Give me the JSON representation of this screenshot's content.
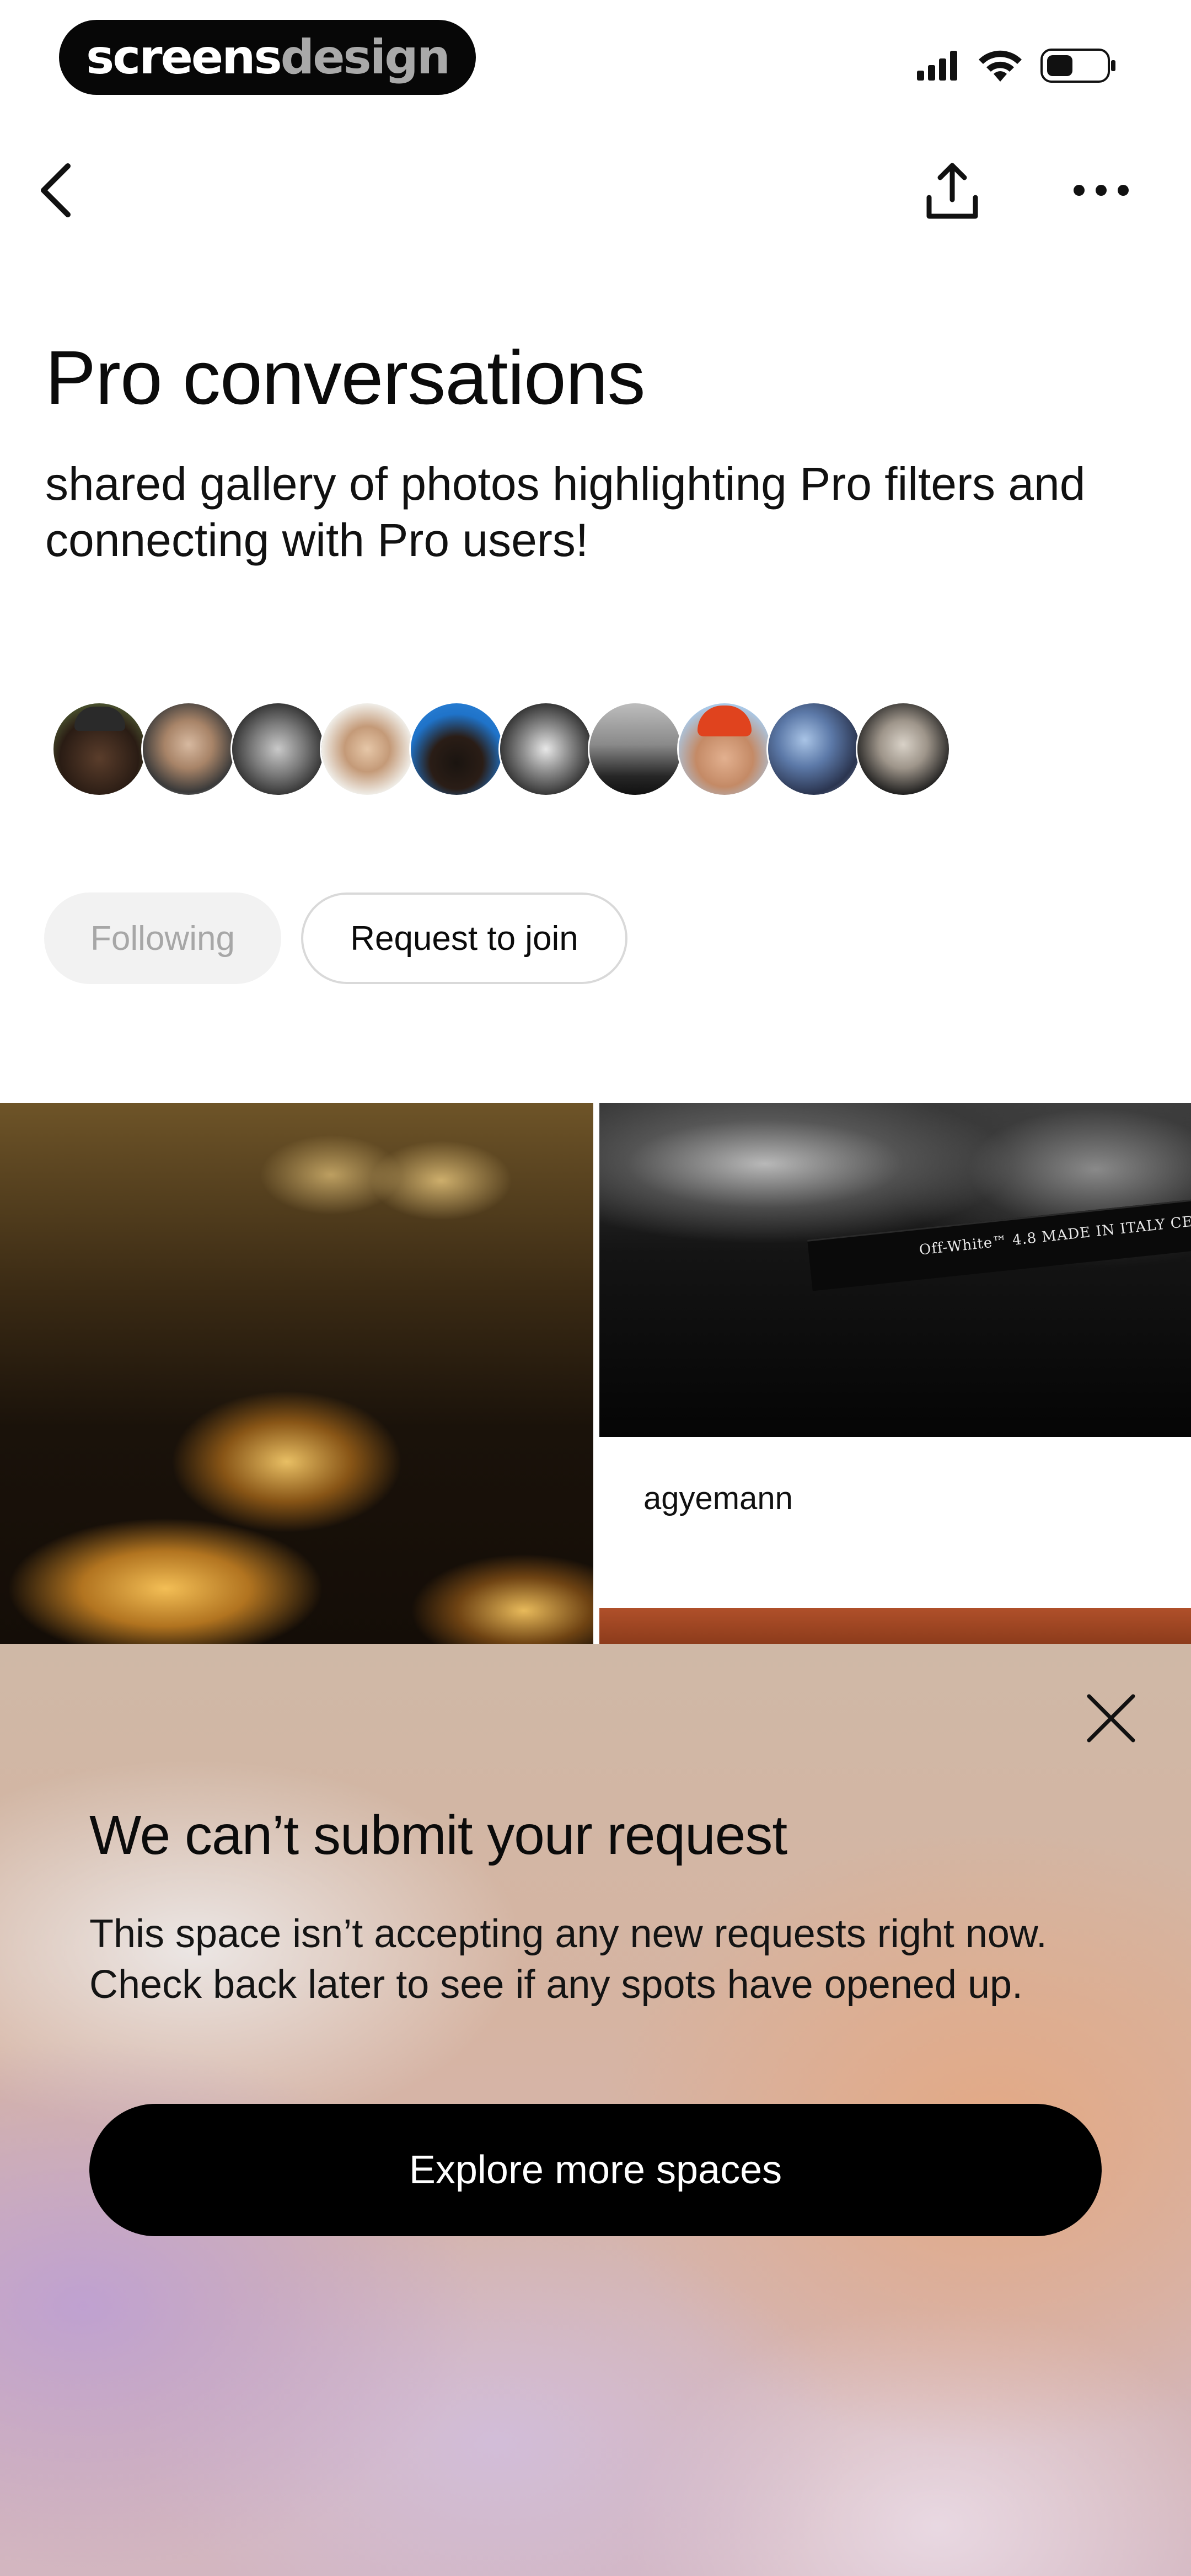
{
  "status_bar": {
    "brand_primary": "screens",
    "brand_secondary": "design",
    "icons": [
      "cellular-signal-icon",
      "wifi-icon",
      "battery-icon"
    ]
  },
  "nav": {
    "back_icon": "chevron-left-icon",
    "share_icon": "share-upload-icon",
    "more_icon": "more-horizontal-icon"
  },
  "space": {
    "title": "Pro conversations",
    "description": "shared gallery of photos highlighting Pro filters and connecting with Pro users!",
    "members_count_shown": 10
  },
  "actions": {
    "following_label": "Following",
    "request_label": "Request to join"
  },
  "gallery": {
    "items": [
      {
        "type": "photo",
        "subject": "candles-in-cathedral"
      },
      {
        "type": "photo",
        "subject": "black-white-strap",
        "strap_text": "Off-White™  4.8  MADE IN ITALY  CE",
        "caption": "agyemann"
      },
      {
        "type": "photo",
        "subject": "rust-texture"
      }
    ]
  },
  "sheet": {
    "title": "We can’t submit your request",
    "body": "This space isn’t accepting any new requests right now. Check back later to see if any spots have opened up.",
    "cta_label": "Explore more spaces",
    "close_icon": "close-icon"
  },
  "colors": {
    "text_primary": "#0b0b0b",
    "following_bg": "#f2f2f2",
    "following_text": "#a7a7a7",
    "cta_bg": "#000000",
    "cta_text": "#ffffff"
  }
}
